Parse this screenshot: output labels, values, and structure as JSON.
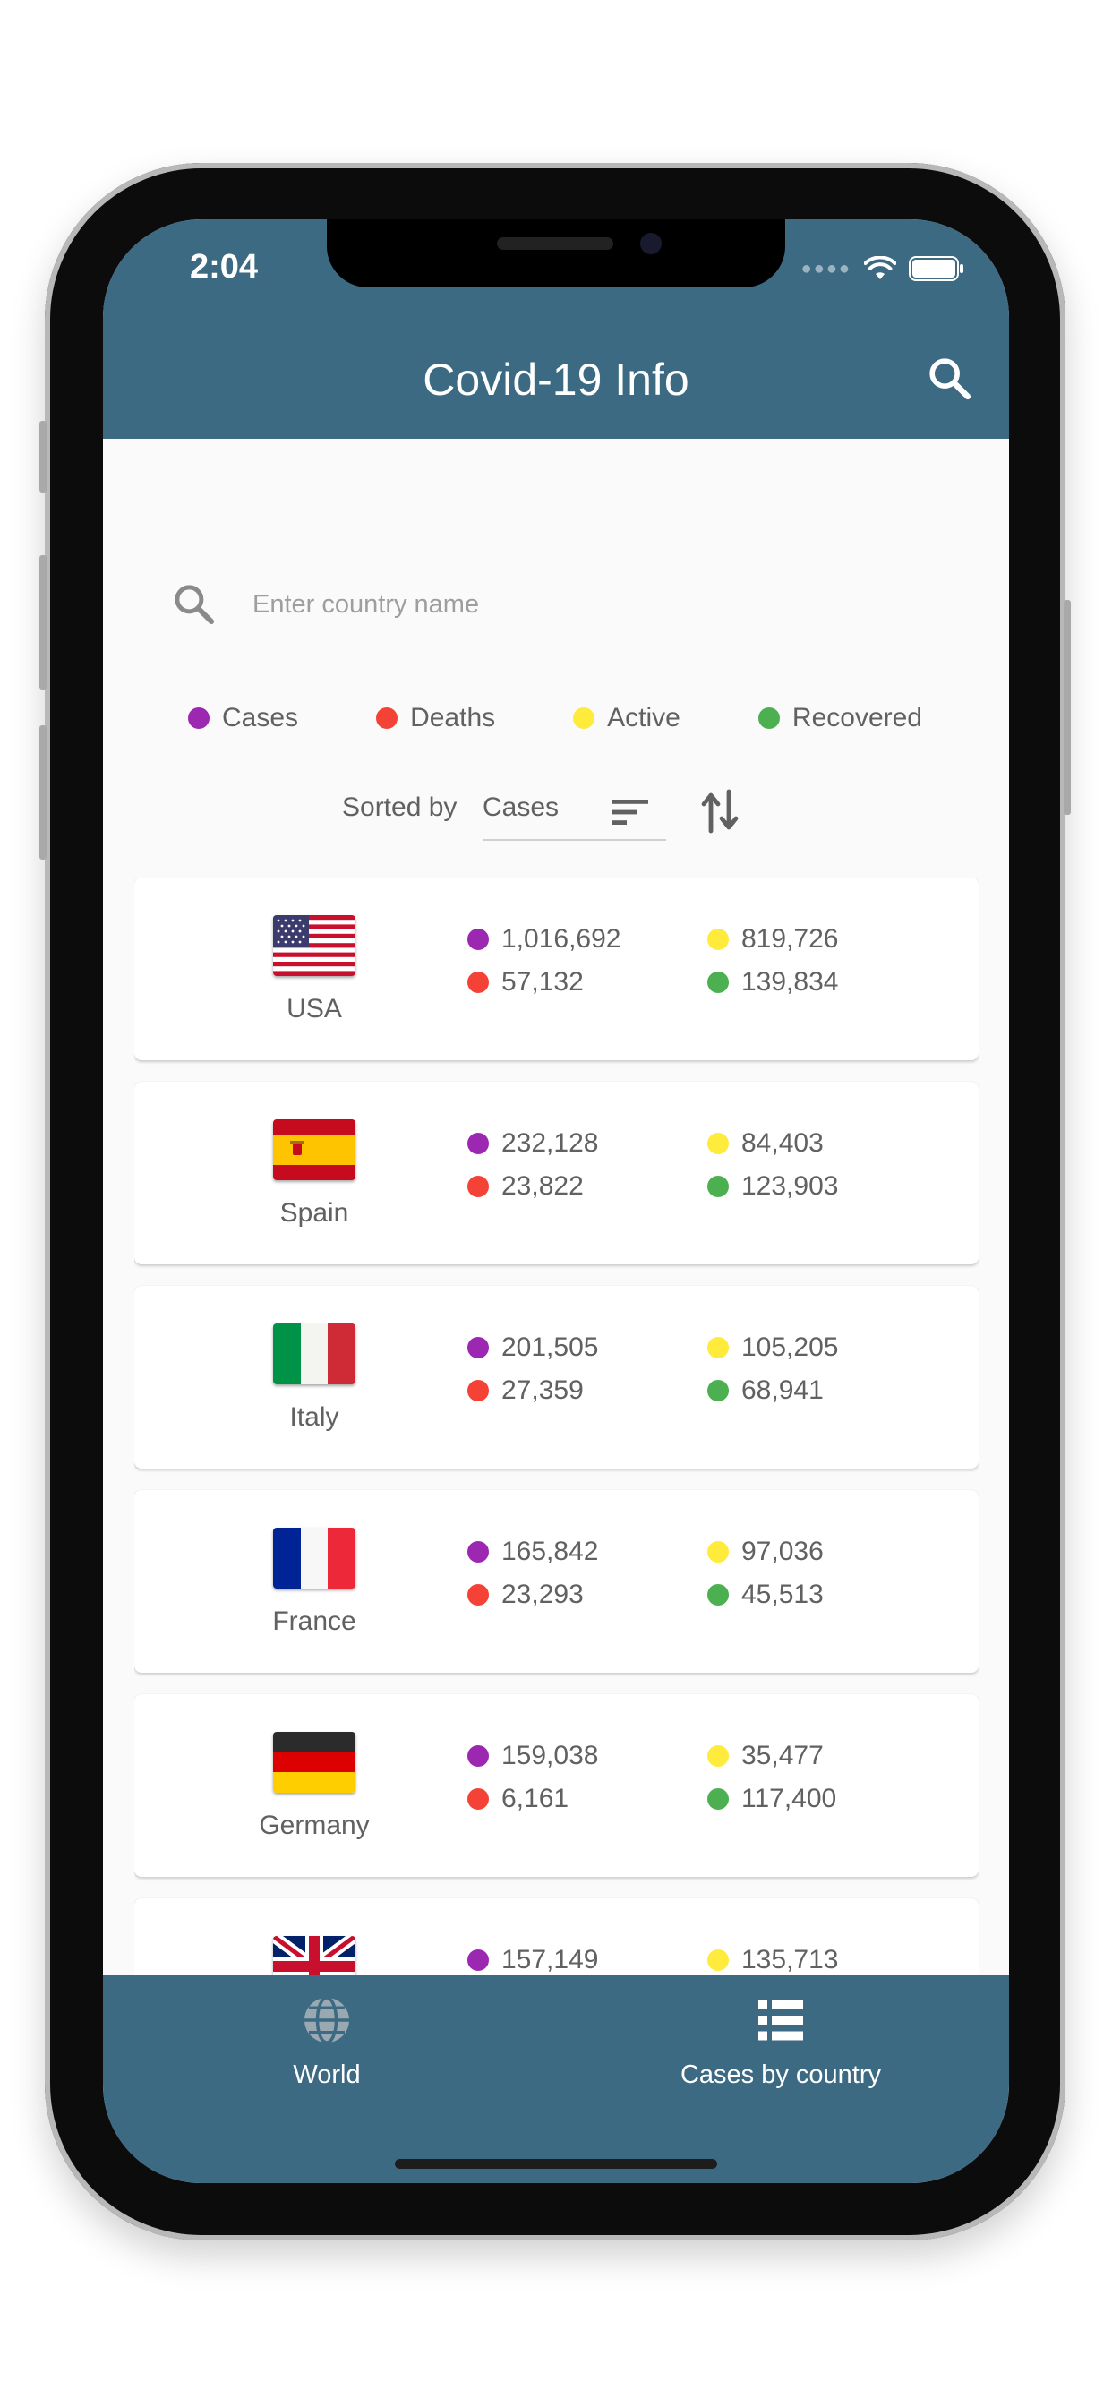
{
  "status_bar": {
    "time": "2:04"
  },
  "app_bar": {
    "title": "Covid-19 Info",
    "search_icon": "search-icon"
  },
  "search": {
    "placeholder": "Enter country name",
    "icon": "search-icon"
  },
  "legend": [
    {
      "label": "Cases",
      "color": "#9c27b0"
    },
    {
      "label": "Deaths",
      "color": "#f44336"
    },
    {
      "label": "Active",
      "color": "#ffeb3b"
    },
    {
      "label": "Recovered",
      "color": "#4caf50"
    }
  ],
  "sort": {
    "label": "Sorted by",
    "value": "Cases",
    "icon": "sort-icon",
    "direction_icon": "swap-vert-icon"
  },
  "countries": [
    {
      "name": "USA",
      "flag": "usa",
      "cases": "1,016,692",
      "deaths": "57,132",
      "active": "819,726",
      "recovered": "139,834"
    },
    {
      "name": "Spain",
      "flag": "spain",
      "cases": "232,128",
      "deaths": "23,822",
      "active": "84,403",
      "recovered": "123,903"
    },
    {
      "name": "Italy",
      "flag": "italy",
      "cases": "201,505",
      "deaths": "27,359",
      "active": "105,205",
      "recovered": "68,941"
    },
    {
      "name": "France",
      "flag": "france",
      "cases": "165,842",
      "deaths": "23,293",
      "active": "97,036",
      "recovered": "45,513"
    },
    {
      "name": "Germany",
      "flag": "germany",
      "cases": "159,038",
      "deaths": "6,161",
      "active": "35,477",
      "recovered": "117,400"
    },
    {
      "name": "",
      "flag": "uk",
      "cases": "157,149",
      "deaths": "",
      "active": "135,713",
      "recovered": ""
    }
  ],
  "bottom_nav": [
    {
      "label": "World",
      "icon": "globe-icon"
    },
    {
      "label": "Cases by country",
      "icon": "list-icon"
    }
  ],
  "colors": {
    "primary": "#3b6a82",
    "background": "#fafafa",
    "text": "#616161"
  }
}
